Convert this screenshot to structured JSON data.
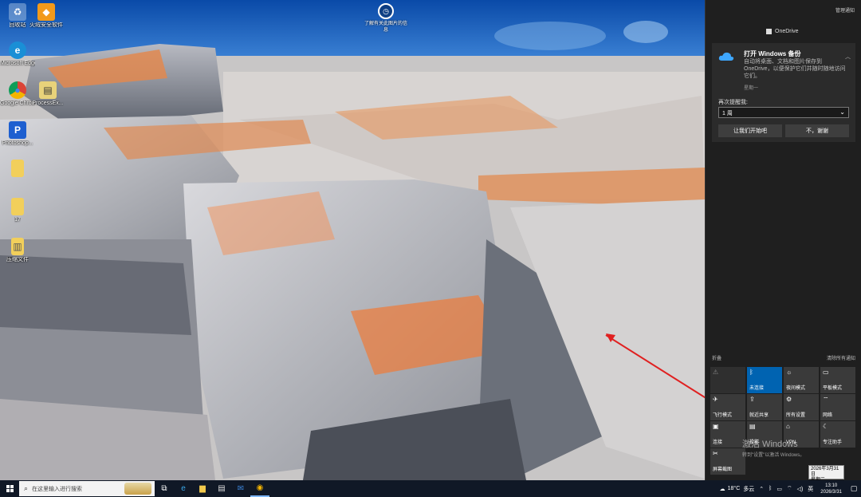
{
  "desktop": {
    "icons": [
      {
        "label": "回收站",
        "icon": "recycle-bin-icon"
      },
      {
        "label": "火绒安全软件",
        "icon": "shield-icon"
      },
      {
        "label": "Microsoft Edge",
        "icon": "edge-icon"
      },
      {
        "label": "Google Chrome",
        "icon": "chrome-icon"
      },
      {
        "label": "ProcessEx...",
        "icon": "file-icon"
      },
      {
        "label": "Photoshop...",
        "icon": "photoshop-icon"
      },
      {
        "label": "",
        "icon": "folder-icon"
      },
      {
        "label": "17",
        "icon": "folder-icon"
      },
      {
        "label": "压缩文件",
        "icon": "zip-icon"
      }
    ],
    "learn_icon": {
      "label": "了解有关此图片的信息"
    }
  },
  "action_center": {
    "manage_label": "管理通知",
    "notification": {
      "app_name": "OneDrive",
      "title": "打开 Windows 备份",
      "body": "自动将桌面、文档和图片保存到 OneDrive，以便保护它们并随时随地访问它们。",
      "time": "星期一",
      "remind_label": "再次提醒我:",
      "remind_value": "1 周",
      "start_button": "让我们开始吧",
      "no_button": "不，谢谢"
    },
    "collapse_label": "折叠",
    "clear_all_label": "清除所有通知",
    "tiles": [
      {
        "label": "",
        "icon": "battery-icon",
        "state": "dim"
      },
      {
        "label": "未连接",
        "icon": "bluetooth-icon",
        "state": "on"
      },
      {
        "label": "夜间模式",
        "icon": "night-light-icon",
        "state": "off"
      },
      {
        "label": "平板模式",
        "icon": "tablet-icon",
        "state": "off"
      },
      {
        "label": "飞行模式",
        "icon": "airplane-icon",
        "state": "off"
      },
      {
        "label": "就近共享",
        "icon": "share-icon",
        "state": "off"
      },
      {
        "label": "所有设置",
        "icon": "gear-icon",
        "state": "off"
      },
      {
        "label": "网络",
        "icon": "network-icon",
        "state": "off"
      },
      {
        "label": "连接",
        "icon": "connect-icon",
        "state": "off"
      },
      {
        "label": "投影",
        "icon": "project-icon",
        "state": "off"
      },
      {
        "label": "VPN",
        "icon": "vpn-icon",
        "state": "off"
      },
      {
        "label": "专注助手",
        "icon": "moon-icon",
        "state": "off"
      },
      {
        "label": "屏幕截图",
        "icon": "screenshot-icon",
        "state": "off"
      }
    ],
    "activate": {
      "line1": "激活 Windows",
      "line2": "转到\"设置\"以激活 Windows。"
    },
    "date_tooltip": {
      "line1": "2026年3月31日",
      "line2": "星期二"
    }
  },
  "taskbar": {
    "search_placeholder": "在这里输入进行搜索",
    "apps": [
      {
        "name": "task-view-icon",
        "glyph": "⧉"
      },
      {
        "name": "edge-icon",
        "glyph": "e"
      },
      {
        "name": "file-explorer-icon",
        "glyph": "▆"
      },
      {
        "name": "store-icon",
        "glyph": "▤"
      },
      {
        "name": "mail-icon",
        "glyph": "✉"
      },
      {
        "name": "chrome-icon",
        "glyph": "◉"
      }
    ],
    "tray": {
      "weather_temp": "18°C",
      "weather_desc": "多云",
      "ime": "英",
      "time": "13:10",
      "date": "2026/3/31"
    }
  },
  "colors": {
    "accent": "#0063b1",
    "panel_bg": "#1f1f1f",
    "taskbar_bg": "#101826",
    "arrow": "#e02020"
  }
}
